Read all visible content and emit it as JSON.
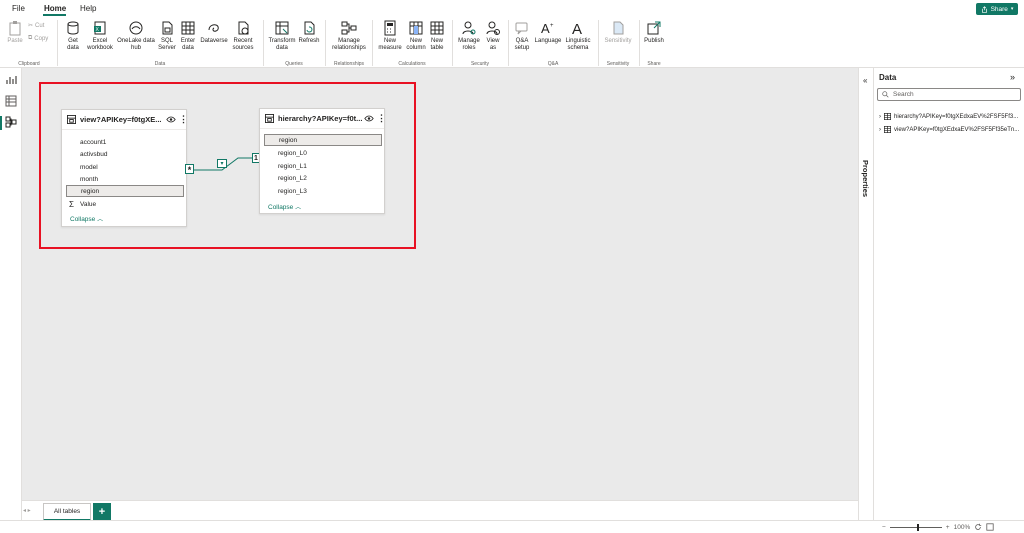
{
  "menubar": {
    "items": [
      "File",
      "Home",
      "Help"
    ],
    "active": "Home",
    "share_label": "Share"
  },
  "ribbon": {
    "clipboard": {
      "paste": "Paste",
      "cut": "Cut",
      "copy": "Copy",
      "group": "Clipboard"
    },
    "data": {
      "get_data": "Get data",
      "excel_workbook": "Excel workbook",
      "onelake": "OneLake data hub",
      "sql_server": "SQL Server",
      "enter_data": "Enter data",
      "dataverse": "Dataverse",
      "recent_sources": "Recent sources",
      "group": "Data"
    },
    "queries": {
      "transform": "Transform data",
      "refresh": "Refresh",
      "group": "Queries"
    },
    "relationships": {
      "manage": "Manage relationships",
      "group": "Relationships"
    },
    "calculations": {
      "new_measure": "New measure",
      "new_column": "New column",
      "new_table": "New table",
      "group": "Calculations"
    },
    "security": {
      "manage_roles": "Manage roles",
      "view_as": "View as",
      "group": "Security"
    },
    "qa": {
      "qa_setup": "Q&A setup",
      "language": "Language",
      "linguistic_schema": "Linguistic schema",
      "group": "Q&A"
    },
    "sensitivity": {
      "label": "Sensitivity",
      "group": "Sensitivity"
    },
    "share": {
      "publish": "Publish",
      "group": "Share"
    }
  },
  "canvas": {
    "tables": [
      {
        "title": "view?APIKey=f0tgXE...",
        "fields": [
          "account1",
          "activsbud",
          "model",
          "month",
          "region"
        ],
        "selected_field": "region",
        "measure": "Value",
        "collapse_label": "Collapse"
      },
      {
        "title": "hierarchy?APIKey=f0t...",
        "fields": [
          "region",
          "region_L0",
          "region_L1",
          "region_L2",
          "region_L3"
        ],
        "selected_field": "region",
        "collapse_label": "Collapse"
      }
    ],
    "relationship": {
      "from_cardinality": "*",
      "to_cardinality": "1"
    }
  },
  "bottombar": {
    "tab_all_tables": "All tables",
    "add_tab": "+"
  },
  "statusbar": {
    "zoom_level": "100%",
    "zoom_fraction": 0.5
  },
  "properties_pane": {
    "label": "Properties"
  },
  "data_pane": {
    "title": "Data",
    "search_placeholder": "Search",
    "items": [
      "hierarchy?APIKey=f0tgXEdxaEV%2FSF5Ff3...",
      "view?APIKey=f0tgXEdxaEV%2FSF5Ff35eTn..."
    ]
  },
  "colors": {
    "accent": "#117865",
    "highlight": "#e81123",
    "canvas": "#eaeaea"
  }
}
